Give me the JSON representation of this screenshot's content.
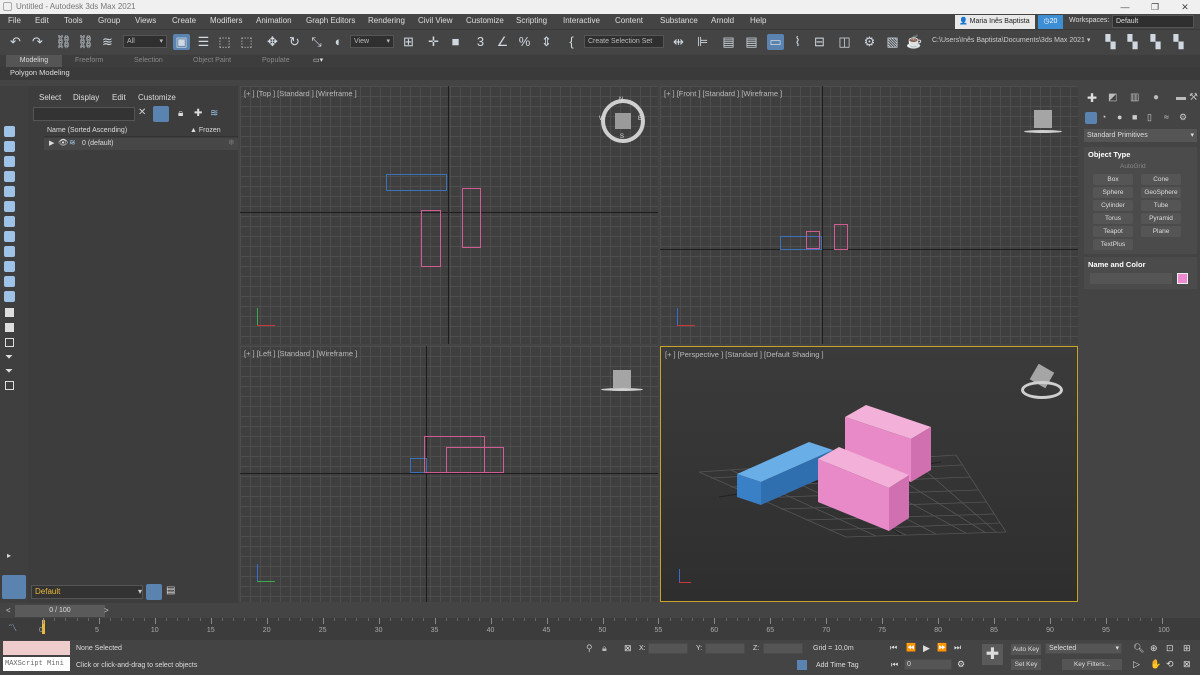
{
  "titlebar": {
    "title": "Untitled - Autodesk 3ds Max 2021",
    "min": "—",
    "max": "❐",
    "close": "✕"
  },
  "menu": [
    "File",
    "Edit",
    "Tools",
    "Group",
    "Views",
    "Create",
    "Modifiers",
    "Animation",
    "Graph Editors",
    "Rendering",
    "Civil View",
    "Customize",
    "Scripting",
    "Interactive",
    "Content",
    "Substance",
    "Arnold",
    "Help"
  ],
  "user": {
    "name": "Maria Inês Baptista",
    "badge": "20",
    "workspaces_label": "Workspaces:",
    "workspace": "Default"
  },
  "toolbar": {
    "filter": "All",
    "view": "View",
    "selection_set": "Create Selection Set",
    "path": "C:\\Users\\Inês Baptista\\Documents\\3ds Max 2021"
  },
  "ribbon": {
    "tabs": [
      "Modeling",
      "Freeform",
      "Selection",
      "Object Paint",
      "Populate"
    ],
    "sub": "Polygon Modeling"
  },
  "explorer": {
    "menus": [
      "Select",
      "Display",
      "Edit",
      "Customize"
    ],
    "col_name": "Name (Sorted Ascending)",
    "col_frozen": "▲ Frozen",
    "layer": "0 (default)",
    "layer_field": "Default"
  },
  "viewports": {
    "top": "[+ ] [Top ] [Standard ] [Wireframe ]",
    "front": "[+ ] [Front ] [Standard ] [Wireframe ]",
    "left": "[+ ] [Left ] [Standard ] [Wireframe ]",
    "persp": "[+ ] [Perspective ] [Standard ] [Default Shading ]",
    "compass": {
      "n": "N",
      "s": "S",
      "e": "E",
      "w": "W"
    }
  },
  "command_panel": {
    "dropdown": "Standard Primitives",
    "object_type": "Object Type",
    "autogrid": "AutoGrid",
    "buttons": [
      "Box",
      "Cone",
      "Sphere",
      "GeoSphere",
      "Cylinder",
      "Tube",
      "Torus",
      "Pyramid",
      "Teapot",
      "Plane",
      "TextPlus"
    ],
    "name_color": "Name and Color"
  },
  "timeline": {
    "frame": "0 / 100",
    "ticks": [
      "0",
      "5",
      "10",
      "15",
      "20",
      "25",
      "30",
      "35",
      "40",
      "45",
      "50",
      "55",
      "60",
      "65",
      "70",
      "75",
      "80",
      "85",
      "90",
      "95",
      "100"
    ]
  },
  "status": {
    "selection": "None Selected",
    "prompt": "Click or click-and-drag to select objects",
    "maxscript": "MAXScript Mini",
    "x_label": "X:",
    "y_label": "Y:",
    "z_label": "Z:",
    "grid": "Grid = 10,0m",
    "add_time_tag": "Add Time Tag",
    "auto_key": "Auto Key",
    "selected": "Selected",
    "set_key": "Set Key",
    "key_filters": "Key Filters...",
    "frame_field": "0"
  },
  "colors": {
    "accent": "#5b83b0",
    "pink_obj": "#e88ac8",
    "blue_obj": "#4a8fd0",
    "active_viewport": "#c9a227"
  }
}
